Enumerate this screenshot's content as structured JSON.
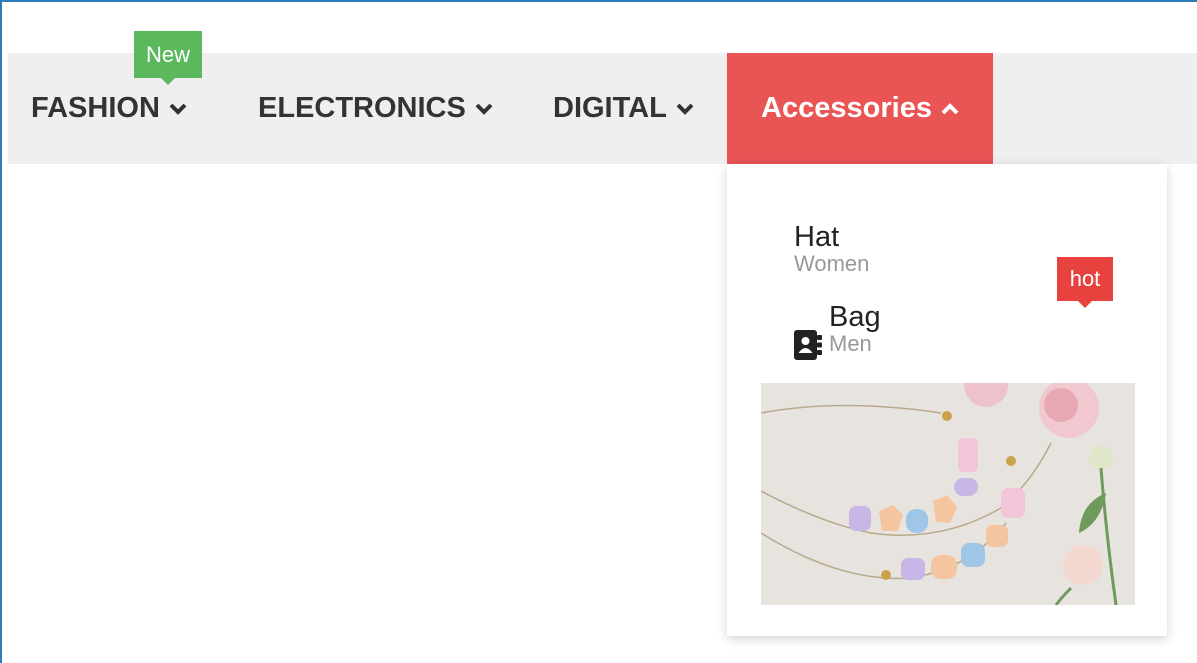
{
  "nav": {
    "items": [
      {
        "label": "FASHION",
        "badge": "New"
      },
      {
        "label": "ELECTRONICS"
      },
      {
        "label": "DIGITAL"
      },
      {
        "label": "Accessories",
        "active": true
      }
    ]
  },
  "dropdown": {
    "items": [
      {
        "title": "Hat",
        "subtitle": "Women"
      },
      {
        "title": "Bag",
        "subtitle": "Men",
        "icon": "contact-book-icon"
      }
    ],
    "hot_badge": "hot",
    "promo_image": "necklace-and-flowers-image"
  },
  "colors": {
    "navbar_bg": "#efefef",
    "active_bg": "#e95455",
    "new_badge": "#5cb85c",
    "hot_badge": "#e8423f"
  }
}
